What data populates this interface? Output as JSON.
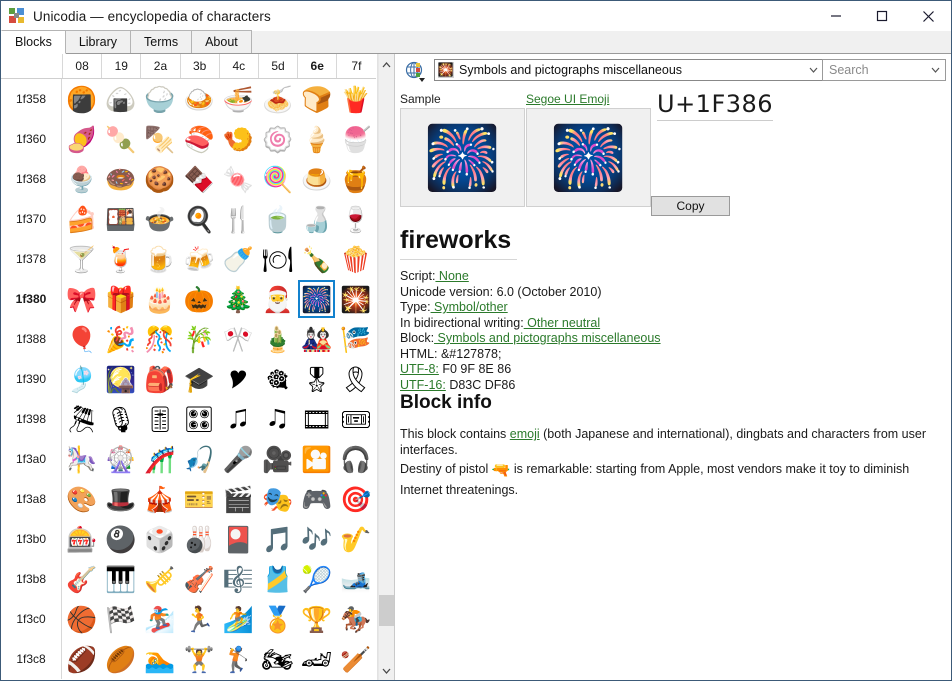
{
  "window": {
    "title": "Unicodia — encyclopedia of characters",
    "app_icon": "unicodia-blocks-icon",
    "controls": {
      "minimize": "minimize-icon",
      "maximize": "maximize-icon",
      "close": "close-icon"
    }
  },
  "tabs": [
    {
      "label": "Blocks",
      "active": true
    },
    {
      "label": "Library",
      "active": false
    },
    {
      "label": "Terms",
      "active": false
    },
    {
      "label": "About",
      "active": false
    }
  ],
  "grid": {
    "columns": [
      "08",
      "19",
      "2a",
      "3b",
      "4c",
      "5d",
      "6e",
      "7f"
    ],
    "selected_column": "6e",
    "selected_row": "1f380",
    "rows": [
      {
        "label": "1f358",
        "cells": [
          "🍘",
          "🍙",
          "🍚",
          "🍛",
          "🍜",
          "🍝",
          "🍞",
          "🍟"
        ]
      },
      {
        "label": "1f360",
        "cells": [
          "🍠",
          "🍡",
          "🍢",
          "🍣",
          "🍤",
          "🍥",
          "🍦",
          "🍧"
        ]
      },
      {
        "label": "1f368",
        "cells": [
          "🍨",
          "🍩",
          "🍪",
          "🍫",
          "🍬",
          "🍭",
          "🍮",
          "🍯"
        ]
      },
      {
        "label": "1f370",
        "cells": [
          "🍰",
          "🍱",
          "🍲",
          "🍳",
          "🍴",
          "🍵",
          "🍶",
          "🍷"
        ]
      },
      {
        "label": "1f378",
        "cells": [
          "🍸",
          "🍹",
          "🍺",
          "🍻",
          "🍼",
          "🍽",
          "🍾",
          "🍿"
        ]
      },
      {
        "label": "1f380",
        "cells": [
          "🎀",
          "🎁",
          "🎂",
          "🎃",
          "🎄",
          "🎅",
          "🎆",
          "🎇"
        ]
      },
      {
        "label": "1f388",
        "cells": [
          "🎈",
          "🎉",
          "🎊",
          "🎋",
          "🎌",
          "🎍",
          "🎎",
          "🎏"
        ]
      },
      {
        "label": "1f390",
        "cells": [
          "🎐",
          "🎑",
          "🎒",
          "🎓",
          "🎔",
          "🎕",
          "🎖",
          "🎗"
        ]
      },
      {
        "label": "1f398",
        "cells": [
          "🎘",
          "🎙",
          "🎚",
          "🎛",
          "🎜",
          "🎝",
          "🎞",
          "🎟"
        ]
      },
      {
        "label": "1f3a0",
        "cells": [
          "🎠",
          "🎡",
          "🎢",
          "🎣",
          "🎤",
          "🎥",
          "🎦",
          "🎧"
        ]
      },
      {
        "label": "1f3a8",
        "cells": [
          "🎨",
          "🎩",
          "🎪",
          "🎫",
          "🎬",
          "🎭",
          "🎮",
          "🎯"
        ]
      },
      {
        "label": "1f3b0",
        "cells": [
          "🎰",
          "🎱",
          "🎲",
          "🎳",
          "🎴",
          "🎵",
          "🎶",
          "🎷"
        ]
      },
      {
        "label": "1f3b8",
        "cells": [
          "🎸",
          "🎹",
          "🎺",
          "🎻",
          "🎼",
          "🎽",
          "🎾",
          "🎿"
        ]
      },
      {
        "label": "1f3c0",
        "cells": [
          "🏀",
          "🏁",
          "🏂",
          "🏃",
          "🏄",
          "🏅",
          "🏆",
          "🏇"
        ]
      },
      {
        "label": "1f3c8",
        "cells": [
          "🏈",
          "🏉",
          "🏊",
          "🏋",
          "🏌",
          "🏍",
          "🏎",
          "🏏"
        ]
      }
    ],
    "scrollbar": {
      "up_arrow": "chevron-up-icon",
      "down_arrow": "chevron-down-icon"
    }
  },
  "toolbar": {
    "grid_icon": "unicode-grid-icon",
    "block_select": {
      "value": "Symbols and pictographs miscellaneous",
      "icon": "🎇",
      "arrow": "chevron-down-icon"
    },
    "search": {
      "placeholder": "Search",
      "value": "",
      "arrow": "chevron-down-icon"
    }
  },
  "detail": {
    "sample_label": "Sample",
    "font_label": "Segoe UI Emoji",
    "sample_glyph": "🎆",
    "font_glyph": "🎆",
    "codepoint": "U+1F386",
    "copy_label": "Copy",
    "name": "fireworks",
    "properties": [
      {
        "label": "Script:",
        "value": "None",
        "link": true
      },
      {
        "label": "Unicode version:",
        "value": "6.0 (October 2010)",
        "link": false
      },
      {
        "label": "Type:",
        "value": "Symbol/other",
        "link": true
      },
      {
        "label": "In bidirectional writing:",
        "value": "Other neutral",
        "link": true
      },
      {
        "label": "Block:",
        "value": "Symbols and pictographs miscellaneous",
        "link": true
      },
      {
        "label": "HTML:",
        "value": "&#127878;",
        "link": false
      },
      {
        "label": "UTF-8:",
        "value": "F0 9F 8E 86",
        "link": false,
        "label_link": true
      },
      {
        "label": "UTF-16:",
        "value": "D83C DF86",
        "link": false,
        "label_link": true
      }
    ],
    "block_info": {
      "heading": "Block info",
      "paragraph1_before": "This block contains ",
      "paragraph1_link": "emoji",
      "paragraph1_after": " (both Japanese and international), dingbats and characters from user interfaces.",
      "paragraph2_before": "Destiny of pistol ",
      "paragraph2_emoji": "🔫",
      "paragraph2_after": " is remarkable: starting from Apple, most vendors make it toy to diminish Internet threatenings."
    }
  },
  "colors": {
    "selection": "#1382ce",
    "link": "#2b7a2b",
    "window_border": "#3c5a78"
  }
}
